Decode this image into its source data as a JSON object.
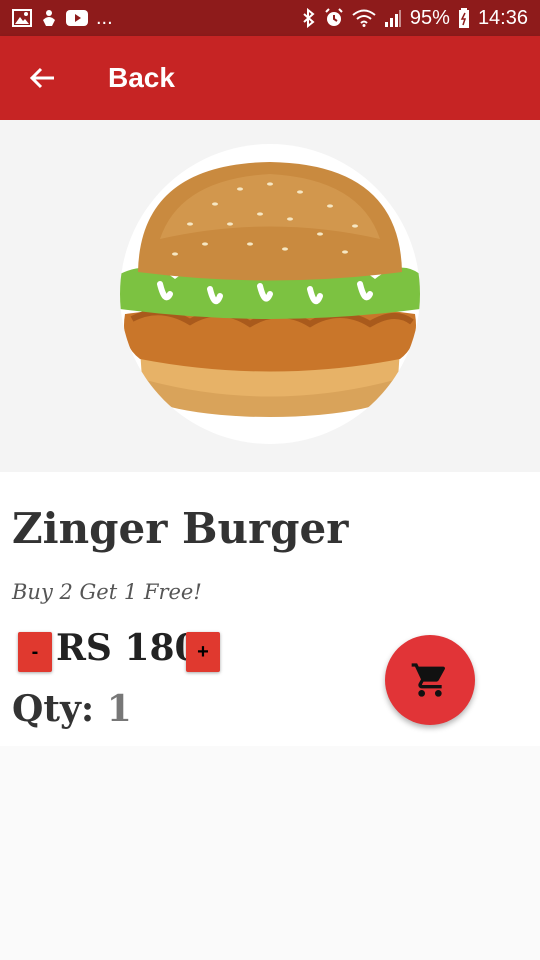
{
  "status_bar": {
    "more_indicator": "...",
    "battery": "95%",
    "time": "14:36",
    "icons": [
      "gallery-icon",
      "download-icon",
      "youtube-icon",
      "bluetooth-icon",
      "alarm-icon",
      "wifi-icon",
      "signal-icon",
      "battery-icon"
    ]
  },
  "appbar": {
    "title": "Back",
    "background": "#c62424",
    "back_icon": "arrow-left-icon"
  },
  "product": {
    "image": "zinger-burger-image",
    "name": "Zinger Burger",
    "promo": "Buy 2 Get 1 Free!",
    "price": "RS 180",
    "qty_label": "Qty:",
    "qty_value": "1"
  },
  "controls": {
    "minus_label": "-",
    "plus_label": "+",
    "button_color": "#e0392f",
    "cart_icon": "cart-icon",
    "fab_color": "#e13437"
  }
}
